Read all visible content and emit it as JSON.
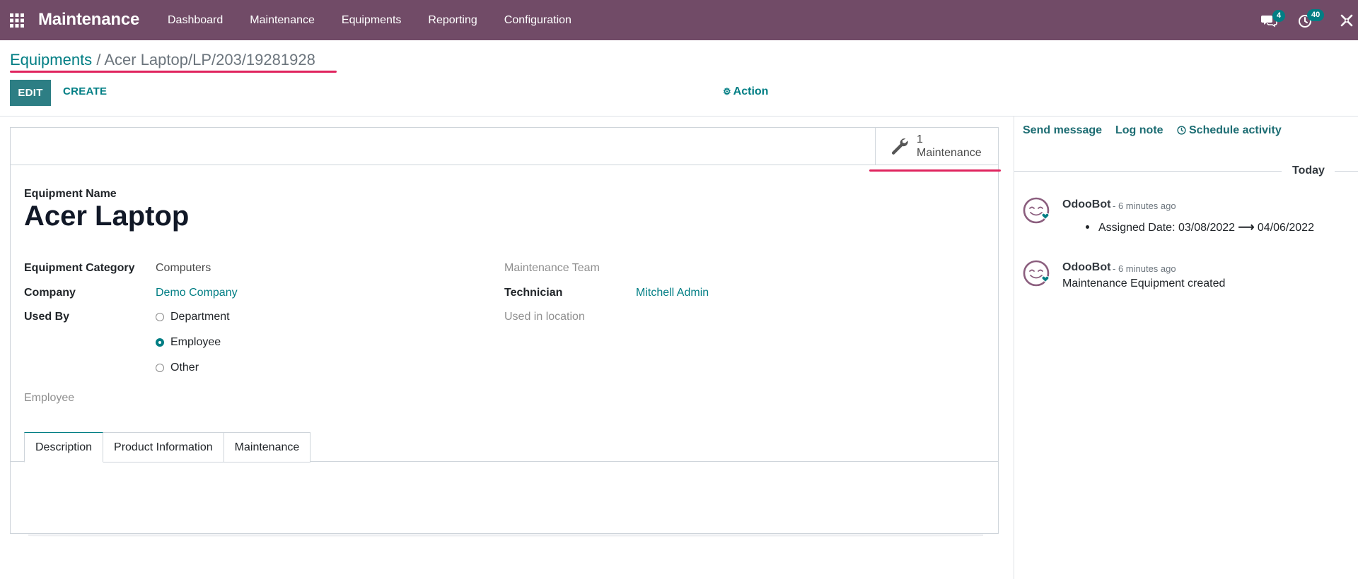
{
  "navbar": {
    "brand": "Maintenance",
    "menu": [
      {
        "label": "Dashboard"
      },
      {
        "label": "Maintenance"
      },
      {
        "label": "Equipments"
      },
      {
        "label": "Reporting"
      },
      {
        "label": "Configuration"
      }
    ],
    "messages_badge": "4",
    "activities_badge": "40",
    "icons": {
      "apps": "apps-grid-icon",
      "messages": "chat-bubbles-icon",
      "activities": "clock-icon",
      "debug": "bug-close-icon"
    },
    "background": "#714b67"
  },
  "breadcrumb": {
    "parent": "Equipments",
    "separator": "/",
    "current": "Acer Laptop/LP/203/19281928"
  },
  "toolbar": {
    "edit_label": "EDIT",
    "create_label": "CREATE",
    "action_label": "Action",
    "accent": "#017e84"
  },
  "smart_button": {
    "count": "1",
    "label": "Maintenance",
    "icon": "wrench-icon"
  },
  "form": {
    "name_label": "Equipment Name",
    "name": "Acer Laptop",
    "fields_left": {
      "category_label": "Equipment Category",
      "category_value": "Computers",
      "company_label": "Company",
      "company_value": "Demo Company",
      "used_by_label": "Used By",
      "used_by_options": [
        "Department",
        "Employee",
        "Other"
      ],
      "used_by_selected": "Employee",
      "employee_label": "Employee"
    },
    "fields_right": {
      "team_label": "Maintenance Team",
      "technician_label": "Technician",
      "technician_value": "Mitchell Admin",
      "location_label": "Used in location"
    },
    "tabs": [
      {
        "label": "Description",
        "active": true
      },
      {
        "label": "Product Information",
        "active": false
      },
      {
        "label": "Maintenance",
        "active": false
      }
    ]
  },
  "chatter": {
    "send_message": "Send message",
    "log_note": "Log note",
    "schedule_activity": "Schedule activity",
    "date_separator": "Today",
    "messages": [
      {
        "author": "OdooBot",
        "time": "- 6 minutes ago",
        "tracking_field": "Assigned Date:",
        "old_value": "03/08/2022",
        "arrow": "⟶",
        "new_value": "04/06/2022"
      },
      {
        "author": "OdooBot",
        "time": "- 6 minutes ago",
        "body": "Maintenance Equipment created"
      }
    ]
  },
  "highlight_color": "#e0245e"
}
